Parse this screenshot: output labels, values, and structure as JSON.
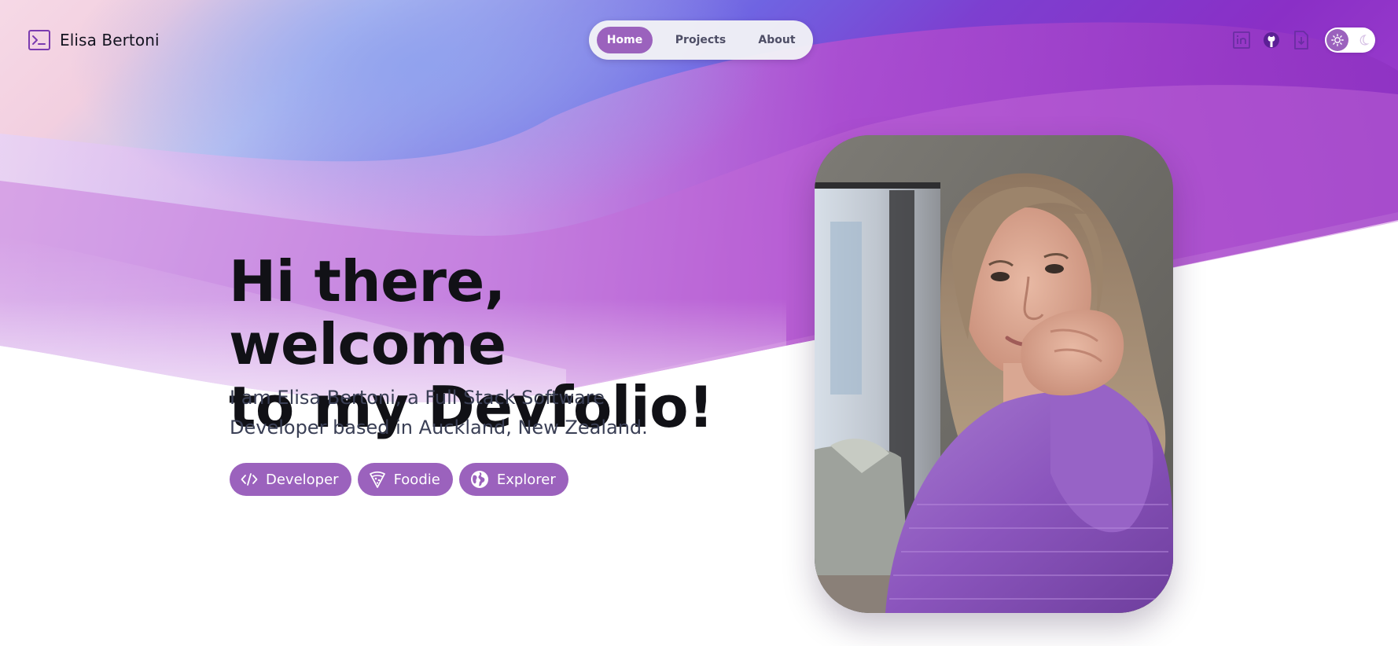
{
  "header": {
    "brand_name": "Elisa Bertoni",
    "brand_icon": "terminal-icon",
    "nav": [
      {
        "label": "Home",
        "active": true
      },
      {
        "label": "Projects",
        "active": false
      },
      {
        "label": "About",
        "active": false
      }
    ],
    "socials": [
      {
        "name": "linkedin-icon"
      },
      {
        "name": "github-icon"
      },
      {
        "name": "download-cv-icon"
      }
    ],
    "theme_toggle": {
      "mode": "light",
      "icons": [
        "sun-icon",
        "moon-icon"
      ]
    }
  },
  "hero": {
    "title_line1": "Hi there, welcome",
    "title_line2": "to my Devfolio!",
    "subtitle_line1": "I am Elisa Bertoni, a Full Stack Software",
    "subtitle_line2": "Developer based in Auckland, New Zealand.",
    "tags": [
      {
        "label": "Developer",
        "icon": "code-icon"
      },
      {
        "label": "Foodie",
        "icon": "pizza-icon"
      },
      {
        "label": "Explorer",
        "icon": "globe-icon"
      }
    ]
  },
  "colors": {
    "accent": "#9b62bd",
    "text_dark": "#111116",
    "text_muted": "#3a3f55",
    "gradient_purple": "#7a2fc4",
    "gradient_blue": "#5a6fe0",
    "gradient_pink": "#e9b7e8"
  }
}
